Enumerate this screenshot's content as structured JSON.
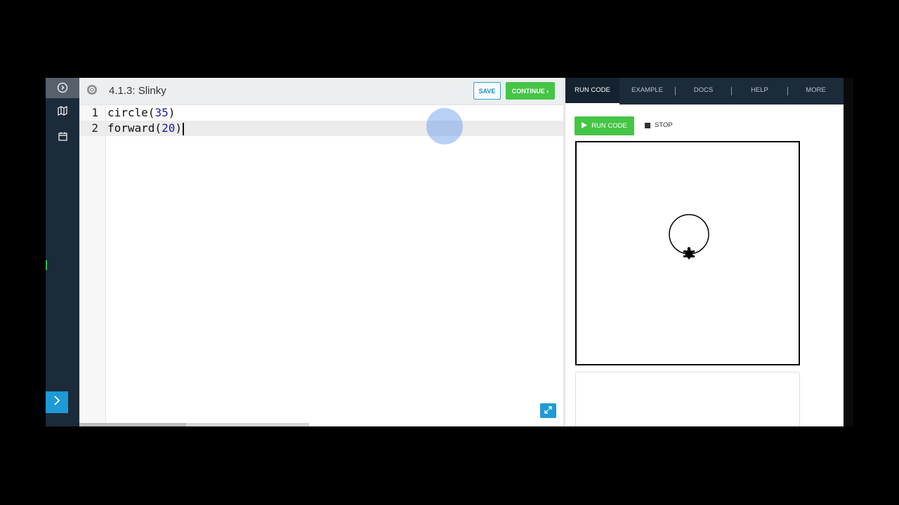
{
  "lesson": {
    "title": "4.1.3: Slinky"
  },
  "header_buttons": {
    "save": "SAVE",
    "continue": "CONTINUE ›"
  },
  "editor": {
    "lines": [
      {
        "number": "1",
        "func": "circle(",
        "arg": "35",
        "close": ")"
      },
      {
        "number": "2",
        "func": "forward(",
        "arg": "20",
        "close": ")"
      }
    ]
  },
  "tabs": [
    "RUN CODE",
    "EXAMPLE",
    "DOCS",
    "HELP",
    "MORE"
  ],
  "controls": {
    "run": "RUN CODE",
    "stop": "STOP"
  },
  "colors": {
    "accent_green": "#45c545",
    "accent_blue": "#1e9ad6",
    "nav_dark": "#1c2b3a"
  },
  "icons": {
    "rail": [
      "help-circle-icon",
      "map-icon",
      "calendar-icon",
      "chevron-right-icon"
    ],
    "editor": [
      "settings-icon",
      "expand-icon"
    ],
    "run": "play-icon",
    "stop": "stop-square-icon",
    "turtle": "turtle-icon"
  }
}
